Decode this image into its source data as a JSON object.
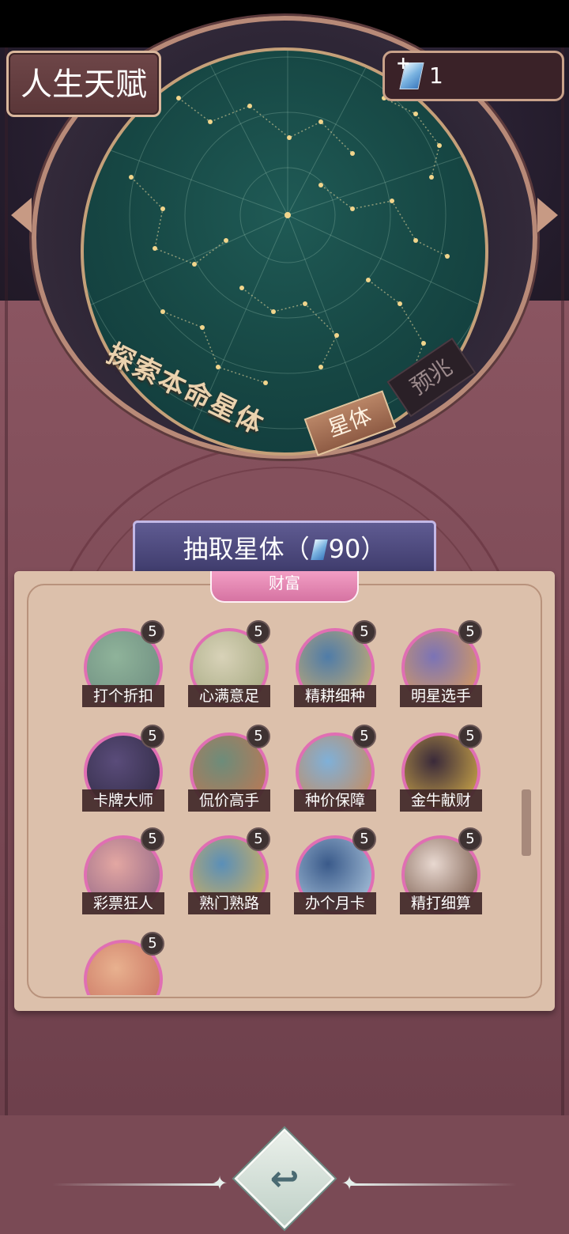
{
  "header": {
    "title": "人生天赋"
  },
  "currency": {
    "count": "1",
    "icon": "crystal-gem-icon",
    "add_icon": "plus-icon"
  },
  "dial": {
    "explore_text": "探索本命星体",
    "tab_star": "星体",
    "tab_omen": "预兆"
  },
  "draw_button": {
    "label": "抽取星体（",
    "cost": "90",
    "close": "）"
  },
  "panel": {
    "category": "财富",
    "talents": [
      {
        "name": "打个折扣",
        "level": "5",
        "color1": "#8fb39a",
        "color2": "#6b8a7e"
      },
      {
        "name": "心满意足",
        "level": "5",
        "color1": "#d8d2b8",
        "color2": "#9fa47a"
      },
      {
        "name": "精耕细种",
        "level": "5",
        "color1": "#4f7ca8",
        "color2": "#d9b36a"
      },
      {
        "name": "明星选手",
        "level": "5",
        "color1": "#7b73b6",
        "color2": "#e7a251"
      },
      {
        "name": "卡牌大师",
        "level": "5",
        "color1": "#5a4c7a",
        "color2": "#2d2840"
      },
      {
        "name": "侃价高手",
        "level": "5",
        "color1": "#6d8c7a",
        "color2": "#c7754f"
      },
      {
        "name": "种价保障",
        "level": "5",
        "color1": "#7fb0d8",
        "color2": "#d2864c"
      },
      {
        "name": "金牛献财",
        "level": "5",
        "color1": "#3a2a3a",
        "color2": "#e2b94a"
      },
      {
        "name": "彩票狂人",
        "level": "5",
        "color1": "#e3a7a2",
        "color2": "#8a5f84"
      },
      {
        "name": "熟门熟路",
        "level": "5",
        "color1": "#5a8fb8",
        "color2": "#e6b64f"
      },
      {
        "name": "办个月卡",
        "level": "5",
        "color1": "#3a5a8a",
        "color2": "#b8d1e6"
      },
      {
        "name": "精打细算",
        "level": "5",
        "color1": "#e8d8d0",
        "color2": "#6a4a3a"
      },
      {
        "name": "",
        "level": "5",
        "color1": "#e8b18f",
        "color2": "#c56a5a"
      }
    ]
  },
  "nav": {
    "back_icon": "return-arrow-icon"
  }
}
